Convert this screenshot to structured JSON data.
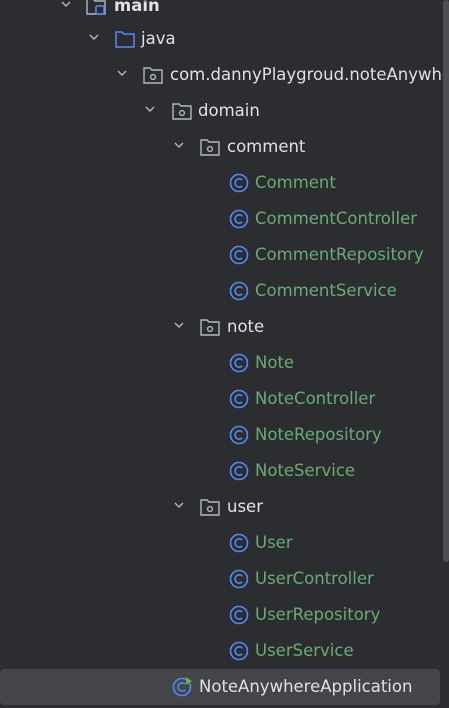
{
  "tree": {
    "root": {
      "label": "main",
      "icon": "source-root-folder-icon"
    },
    "java": {
      "label": "java",
      "icon": "folder-icon"
    },
    "package": {
      "label": "com.dannyPlaygroud.noteAnywhere",
      "icon": "package-icon"
    },
    "domain": {
      "label": "domain",
      "icon": "package-icon"
    },
    "comment": {
      "label": "comment",
      "classes": [
        "Comment",
        "CommentController",
        "CommentRepository",
        "CommentService"
      ]
    },
    "note": {
      "label": "note",
      "classes": [
        "Note",
        "NoteController",
        "NoteRepository",
        "NoteService"
      ]
    },
    "user": {
      "label": "user",
      "classes": [
        "User",
        "UserController",
        "UserRepository",
        "UserService"
      ]
    },
    "app": {
      "label": "NoteAnywhereApplication",
      "icon": "spring-boot-class-icon",
      "selected": true
    }
  },
  "colors": {
    "background": "#2b2d30",
    "text": "#dfe1e5",
    "class_text": "#6aab73",
    "class_icon": "#548af7",
    "selection": "#43454a"
  }
}
